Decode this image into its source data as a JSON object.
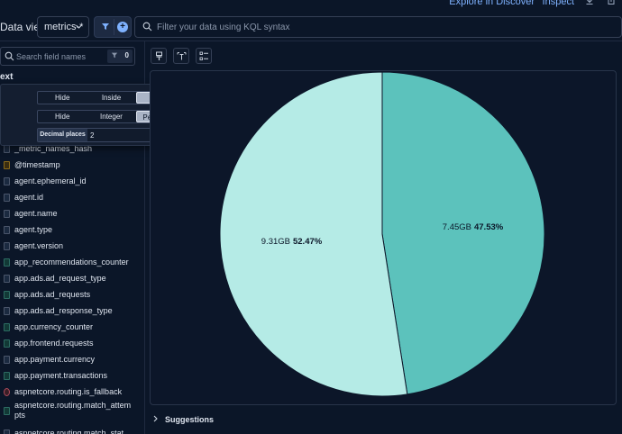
{
  "top_links": {
    "explore": "Explore in Discover",
    "inspect": "Inspect"
  },
  "query_bar": {
    "data_view_label": "Data view",
    "data_view_value": "metrics-*",
    "kql_placeholder": "Filter your data using KQL syntax"
  },
  "sidebar": {
    "search_placeholder": "Search field names",
    "filter_count": "0",
    "section_label": "ext",
    "fields": [
      {
        "name": "_metric_names_hash",
        "type": "kw"
      },
      {
        "name": "@timestamp",
        "type": "date"
      },
      {
        "name": "agent.ephemeral_id",
        "type": "kw"
      },
      {
        "name": "agent.id",
        "type": "kw"
      },
      {
        "name": "agent.name",
        "type": "kw"
      },
      {
        "name": "agent.type",
        "type": "kw"
      },
      {
        "name": "agent.version",
        "type": "kw"
      },
      {
        "name": "app_recommendations_counter",
        "type": "num"
      },
      {
        "name": "app.ads.ad_request_type",
        "type": "kw"
      },
      {
        "name": "app.ads.ad_requests",
        "type": "num"
      },
      {
        "name": "app.ads.ad_response_type",
        "type": "kw"
      },
      {
        "name": "app.currency_counter",
        "type": "num"
      },
      {
        "name": "app.frontend.requests",
        "type": "num"
      },
      {
        "name": "app.payment.currency",
        "type": "kw"
      },
      {
        "name": "app.payment.transactions",
        "type": "num"
      },
      {
        "name": "aspnetcore.routing.is_fallback",
        "type": "bool"
      },
      {
        "name": "aspnetcore.routing.match_attempts",
        "type": "num"
      },
      {
        "name": "aspnetcore.routing.match_stat",
        "type": "kw"
      }
    ]
  },
  "popover": {
    "label_position": {
      "options": [
        "Hide",
        "Inside",
        "Auto"
      ],
      "selected": "Auto"
    },
    "value_format": {
      "options": [
        "Hide",
        "Integer",
        "Percentage"
      ],
      "selected": "Percentage"
    },
    "decimal_places_label": "Decimal places",
    "decimal_places_value": "2"
  },
  "chart_data": {
    "type": "pie",
    "slices": [
      {
        "label": "9.31GB",
        "percent_label": "52.47%",
        "value": 52.47,
        "color": "#b5ebe6"
      },
      {
        "label": "7.45GB",
        "percent_label": "47.53%",
        "value": 47.53,
        "color": "#5cc2bc"
      }
    ]
  },
  "suggestions_label": "Suggestions"
}
